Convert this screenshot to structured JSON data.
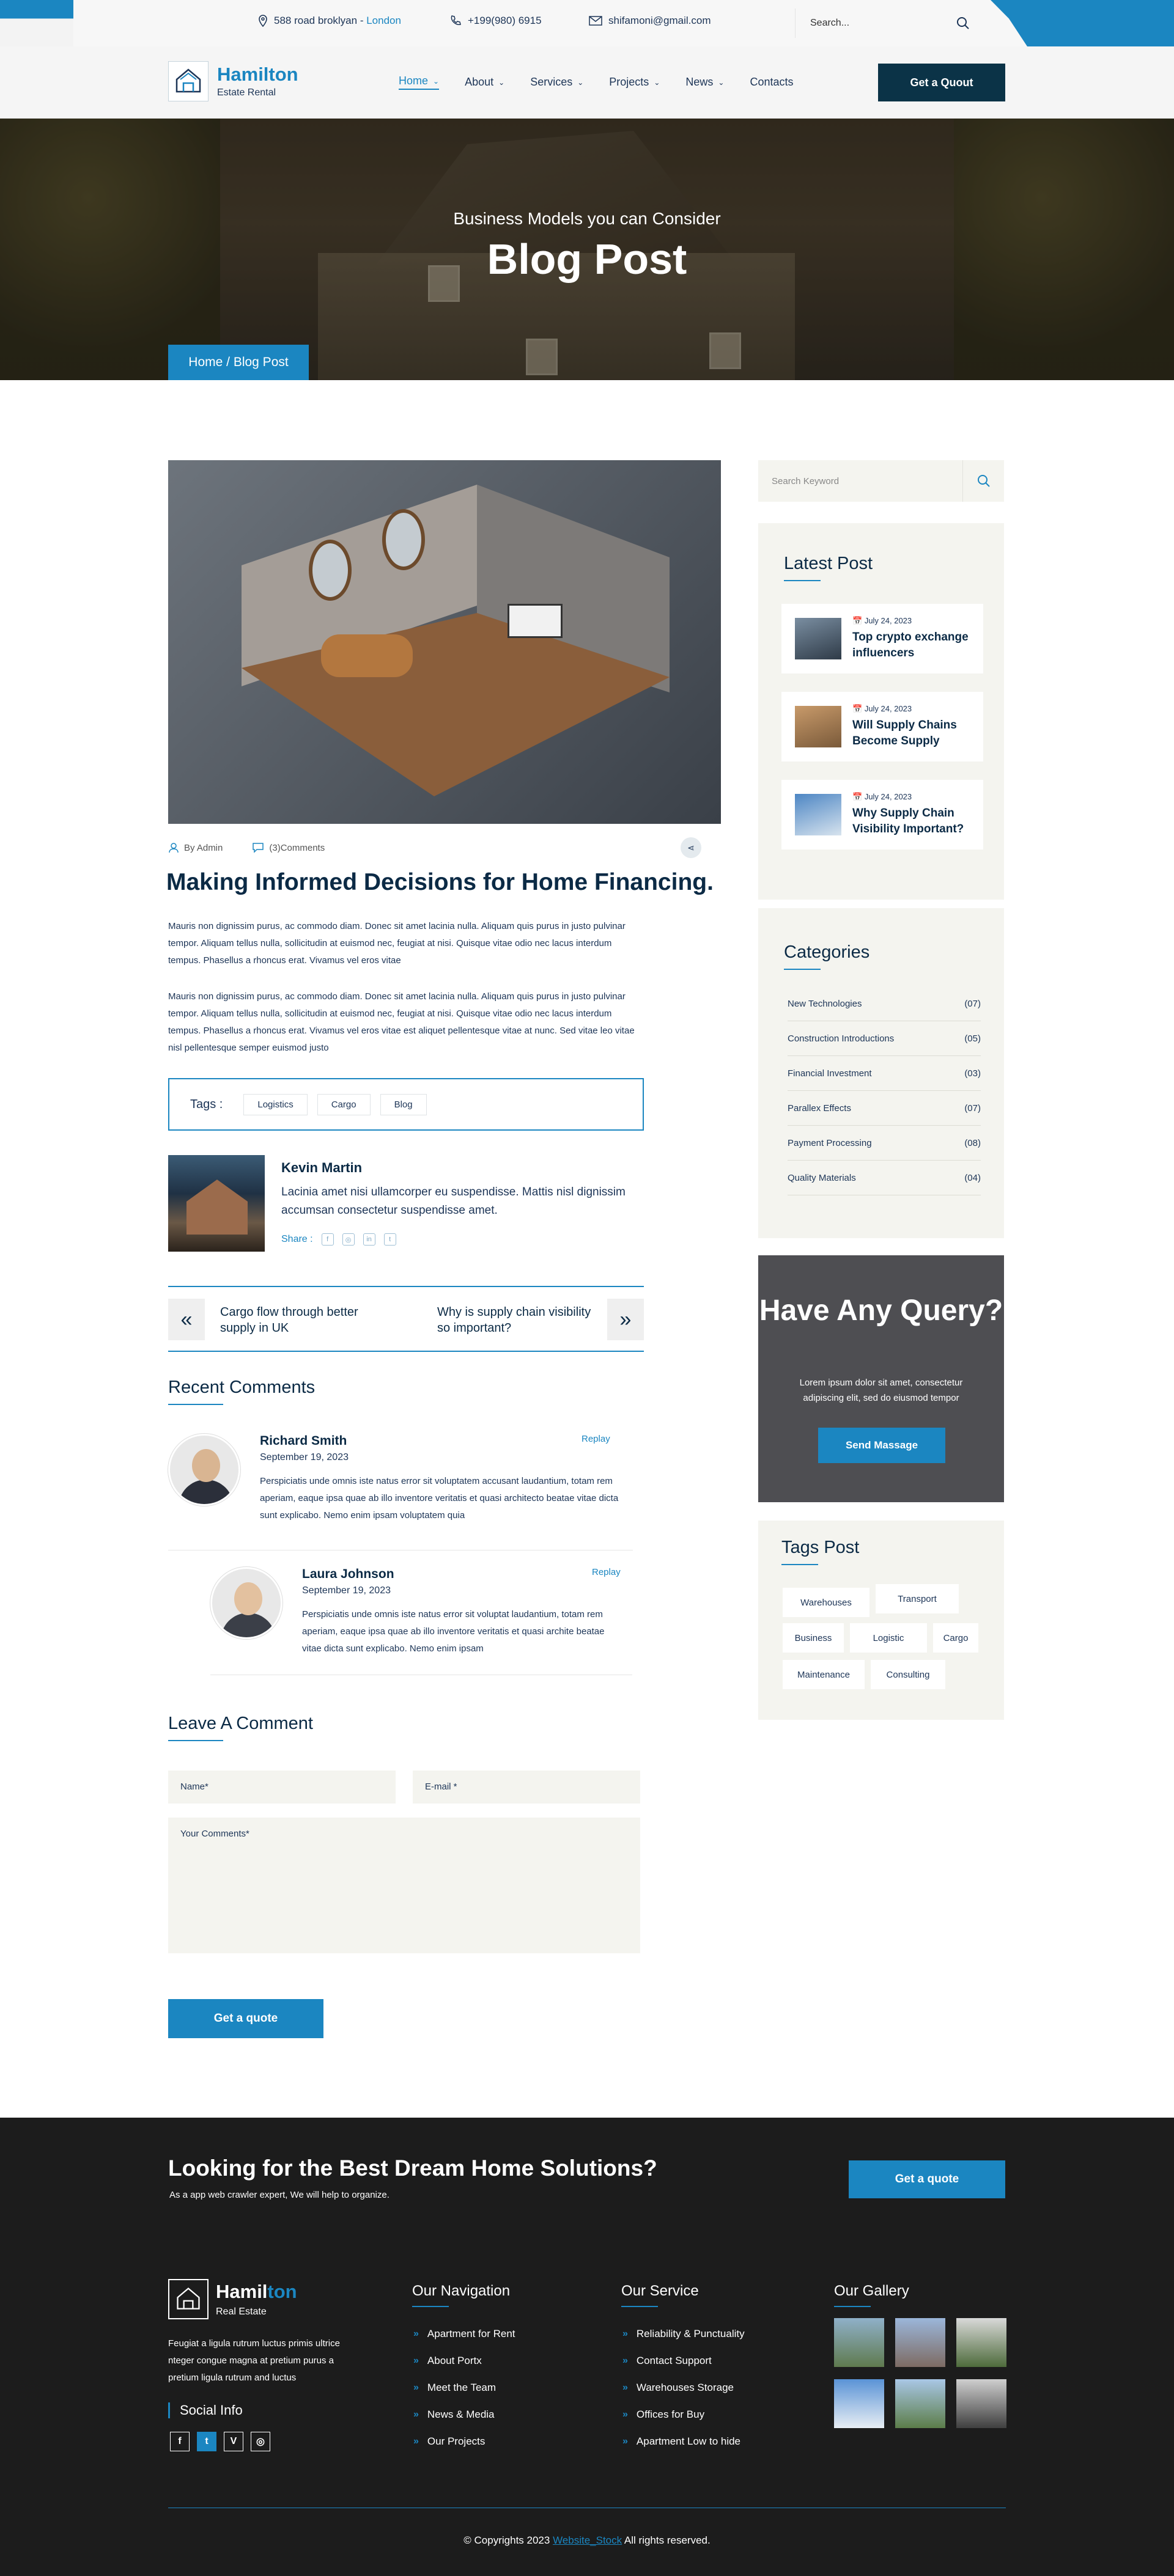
{
  "topbar": {
    "address": "588 road broklyan - ",
    "address_city": "London",
    "phone": "+199(980) 6915",
    "email": "shifamoni@gmail.com",
    "search_placeholder": "Search..."
  },
  "header": {
    "logo_title": "Hamilton",
    "logo_sub": "Estate Rental",
    "nav": [
      {
        "label": "Home"
      },
      {
        "label": "About"
      },
      {
        "label": "Services"
      },
      {
        "label": "Projects"
      },
      {
        "label": "News"
      },
      {
        "label": "Contacts"
      }
    ],
    "quote_label": "Get a Quout"
  },
  "hero": {
    "subtitle": "Business Models you can Consider",
    "title": "Blog Post",
    "breadcrumb": "Home / Blog Post"
  },
  "post": {
    "author": "By Admin",
    "comments": "(3)Comments",
    "title": "Making Informed Decisions for Home Financing.",
    "para1": "Mauris non dignissim purus, ac commodo diam. Donec sit amet lacinia nulla. Aliquam quis purus in justo pulvinar tempor. Aliquam tellus nulla, sollicitudin at euismod nec, feugiat at nisi. Quisque vitae odio nec lacus interdum tempus. Phasellus a rhoncus erat. Vivamus vel eros vitae",
    "para2": "Mauris non dignissim purus, ac commodo diam. Donec sit amet lacinia nulla. Aliquam quis purus in justo pulvinar tempor. Aliquam tellus nulla, sollicitudin at euismod nec, feugiat at nisi. Quisque vitae odio nec lacus interdum tempus. Phasellus a rhoncus erat. Vivamus vel eros vitae est aliquet pellentesque vitae at nunc. Sed vitae leo vitae nisl pellentesque semper euismod justo",
    "tags_label": "Tags :",
    "tags": [
      "Logistics",
      "Cargo",
      "Blog"
    ],
    "author_name": "Kevin Martin",
    "author_bio": "Lacinia amet nisi ullamcorper eu suspendisse. Mattis nisl dignissim accumsan consectetur suspendisse amet.",
    "share_label": "Share :",
    "prev_title": "Cargo flow through better supply in UK",
    "next_title": "Why is supply chain visibility so important?"
  },
  "comments": {
    "heading": "Recent Comments",
    "items": [
      {
        "name": "Richard Smith",
        "date": "September 19, 2023",
        "text": "Perspiciatis unde omnis iste natus error sit voluptatem accusant laudantium, totam rem aperiam, eaque ipsa quae ab illo inventore veritatis et quasi architecto beatae vitae dicta sunt explicabo. Nemo enim ipsam voluptatem quia",
        "reply": "Replay"
      },
      {
        "name": "Laura Johnson",
        "date": "September 19, 2023",
        "text": "Perspiciatis unde omnis iste natus error sit voluptat laudantium, totam rem aperiam, eaque ipsa quae ab illo inventore veritatis et quasi archite beatae vitae dicta sunt explicabo. Nemo enim ipsam",
        "reply": "Replay"
      }
    ]
  },
  "form": {
    "heading": "Leave A Comment",
    "name_placeholder": "Name*",
    "email_placeholder": "E-mail *",
    "comments_placeholder": "Your Comments*",
    "submit": "Get a quote"
  },
  "sidebar": {
    "search_placeholder": "Search Keyword",
    "latest_heading": "Latest Post",
    "latest": [
      {
        "date": "July 24, 2023",
        "title": "Top crypto exchange influencers"
      },
      {
        "date": "July 24, 2023",
        "title": "Will Supply Chains Become Supply"
      },
      {
        "date": "July 24, 2023",
        "title": "Why Supply Chain Visibility Important?"
      }
    ],
    "categories_heading": "Categories",
    "categories": [
      {
        "name": "New Technologies",
        "count": "(07)"
      },
      {
        "name": "Construction Introductions",
        "count": "(05)"
      },
      {
        "name": "Financial Investment",
        "count": "(03)"
      },
      {
        "name": "Parallex Effects",
        "count": "(07)"
      },
      {
        "name": "Payment Processing",
        "count": "(08)"
      },
      {
        "name": "Quality Materials",
        "count": "(04)"
      }
    ],
    "query_title": "Have Any Query?",
    "query_text": "Lorem ipsum dolor sit amet, consectetur adipiscing elit, sed do eiusmod tempor",
    "query_button": "Send Massage",
    "tags_heading": "Tags Post",
    "tags": [
      "Warehouses",
      "Transport",
      "Business",
      "Logistic",
      "Cargo",
      "Maintenance",
      "Consulting"
    ]
  },
  "footer": {
    "cta_title": "Looking for the Best Dream Home Solutions?",
    "cta_sub": "As a app web crawler expert, We will help to organize.",
    "cta_button": "Get a quote",
    "logo_a": "Hamil",
    "logo_b": "ton",
    "logo_sub": "Real Estate",
    "about": "Feugiat a ligula rutrum luctus primis ultrice nteger congue magna at pretium purus a pretium ligula rutrum and luctus",
    "social_heading": "Social Info",
    "social": [
      "f",
      "t",
      "V",
      "◎"
    ],
    "nav_heading": "Our Navigation",
    "nav_links": [
      "Apartment for Rent",
      "About Portx",
      "Meet the Team",
      "News & Media",
      "Our Projects"
    ],
    "service_heading": "Our Service",
    "service_links": [
      "Reliability & Punctuality",
      "Contact Support",
      "Warehouses Storage",
      "Offices for Buy",
      "Apartment Low to hide"
    ],
    "gallery_heading": "Our Gallery",
    "copyright": "© Copyrights 2023 ",
    "copyright_link": "Website_Stock",
    "copyright_tail": " All rights reserved."
  },
  "colors": {
    "accent": "#1b86c1",
    "dark": "#0b3347",
    "footer_bg": "#1c1c1c"
  }
}
